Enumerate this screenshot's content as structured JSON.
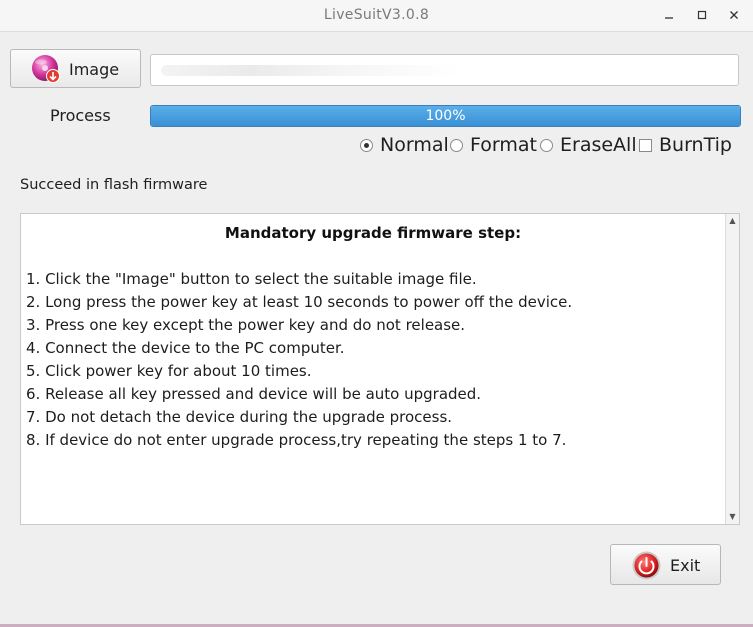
{
  "window": {
    "title": "LiveSuitV3.0.8",
    "controls": {
      "minimize": "–",
      "maximize": "□",
      "close": "✕"
    }
  },
  "image_button": {
    "label": "Image",
    "icon": "image-disc-icon"
  },
  "image_path": {
    "value": ""
  },
  "process": {
    "label": "Process",
    "progress_text": "100%",
    "progress_fraction": 1.0
  },
  "modes": [
    {
      "label": "Normal",
      "type": "radio",
      "checked": true
    },
    {
      "label": "Format",
      "type": "radio",
      "checked": false
    },
    {
      "label": "EraseAll",
      "type": "radio",
      "checked": false
    },
    {
      "label": "BurnTip",
      "type": "checkbox",
      "checked": false
    }
  ],
  "status_text": "Succeed in flash firmware",
  "instructions": {
    "heading": "Mandatory upgrade firmware step:",
    "steps": [
      "1. Click the \"Image\" button to select the suitable image file.",
      "2. Long press the power key at least 10 seconds to power off the device.",
      "3. Press one key except the power key and do not release.",
      "4. Connect the device to the PC computer.",
      "5. Click power key for about 10 times.",
      "6. Release all key pressed and device will be auto upgraded.",
      "7. Do not detach the device during the upgrade process.",
      "8. If device do not enter upgrade process,try repeating the steps 1 to 7."
    ]
  },
  "exit_button": {
    "label": "Exit",
    "icon": "exit-power-icon"
  },
  "colors": {
    "progress": "#3a90d6",
    "accent": "#d4145a"
  }
}
